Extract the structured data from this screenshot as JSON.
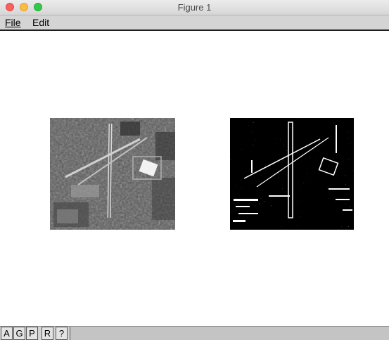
{
  "window": {
    "title": "Figure 1"
  },
  "menu": {
    "file_label": "File",
    "edit_label": "Edit"
  },
  "images": [
    {
      "name": "grayscale-airport-image",
      "description_icon": "photo"
    },
    {
      "name": "binary-airport-image",
      "description_icon": "photo"
    }
  ],
  "toolbar": {
    "buttons": [
      "A",
      "G",
      "P",
      "R",
      "?"
    ],
    "status": ""
  },
  "colors": {
    "menubar": "#d4d4d4",
    "close": "#fc605c",
    "minimize": "#fdbc40",
    "maximize": "#34c84a"
  }
}
